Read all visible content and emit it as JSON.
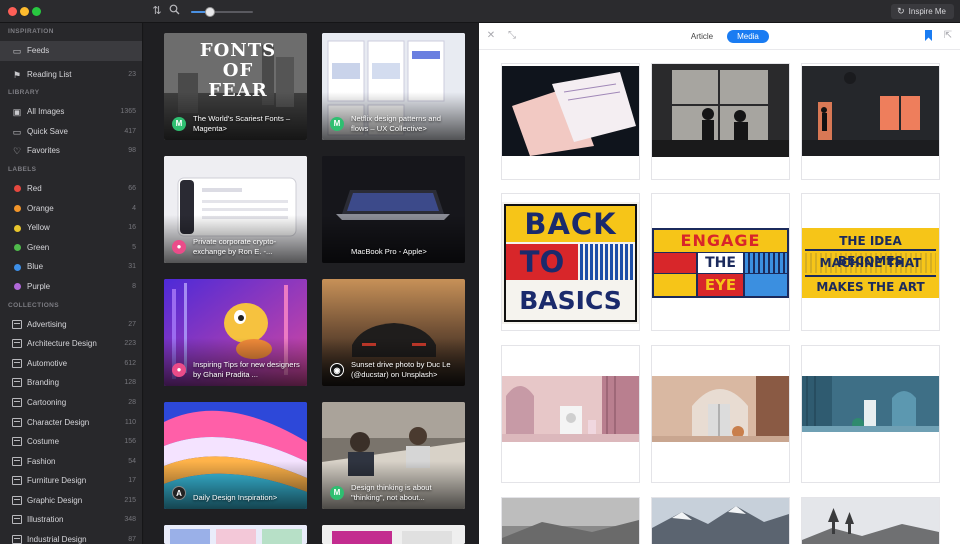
{
  "toolbar": {
    "zoom_percent": 30,
    "inspire_label": "Inspire Me"
  },
  "sidebar": {
    "inspiration_header": "INSPIRATION",
    "feeds_label": "Feeds",
    "reading_list": {
      "label": "Reading List",
      "count": "23"
    },
    "library_header": "LIBRARY",
    "library": [
      {
        "label": "All Images",
        "count": "1365",
        "icon": "images-icon"
      },
      {
        "label": "Quick Save",
        "count": "417",
        "icon": "folder-icon"
      },
      {
        "label": "Favorites",
        "count": "98",
        "icon": "heart-icon"
      }
    ],
    "labels_header": "LABELS",
    "labels": [
      {
        "label": "Red",
        "count": "66",
        "color": "#e5483f"
      },
      {
        "label": "Orange",
        "count": "4",
        "color": "#f2952a"
      },
      {
        "label": "Yellow",
        "count": "16",
        "color": "#e8c52c"
      },
      {
        "label": "Green",
        "count": "5",
        "color": "#4fba4b"
      },
      {
        "label": "Blue",
        "count": "31",
        "color": "#3d8fe8"
      },
      {
        "label": "Purple",
        "count": "8",
        "color": "#b068d8"
      }
    ],
    "collections_header": "COLLECTIONS",
    "collections": [
      {
        "label": "Advertising",
        "count": "27"
      },
      {
        "label": "Architecture Design",
        "count": "223"
      },
      {
        "label": "Automotive",
        "count": "612"
      },
      {
        "label": "Branding",
        "count": "128"
      },
      {
        "label": "Cartooning",
        "count": "28"
      },
      {
        "label": "Character Design",
        "count": "110"
      },
      {
        "label": "Costume",
        "count": "156"
      },
      {
        "label": "Fashion",
        "count": "54"
      },
      {
        "label": "Furniture Design",
        "count": "17"
      },
      {
        "label": "Graphic Design",
        "count": "215"
      },
      {
        "label": "Illustration",
        "count": "348"
      },
      {
        "label": "Industrial Design",
        "count": "87"
      }
    ]
  },
  "feed": {
    "cards": [
      {
        "caption": "The World's Scariest Fonts – Magenta>",
        "badge": "M",
        "badge_color": "#2fbf71",
        "art_text": "FONTS OF FEAR"
      },
      {
        "caption": "Netflix design patterns and flows – UX Collective>",
        "badge": "M",
        "badge_color": "#2fbf71"
      },
      {
        "caption": "Private corporate crypto-exchange by Ron E. -...",
        "badge": "●",
        "badge_color": "#ea4c89"
      },
      {
        "caption": "MacBook Pro - Apple>",
        "badge": "",
        "badge_color": "#222"
      },
      {
        "caption": "Inspiring Tips for new designers by Ghani Pradita ...",
        "badge": "●",
        "badge_color": "#ea4c89"
      },
      {
        "caption": "Sunset drive photo by Duc Le (@ducstar) on Unsplash>",
        "badge": "◉",
        "badge_color": "#111"
      },
      {
        "caption": "Daily Design Inspiration>",
        "badge": "A",
        "badge_color": "#222"
      },
      {
        "caption": "Design thinking is about \"thinking\", not about...",
        "badge": "M",
        "badge_color": "#2fbf71"
      }
    ]
  },
  "pane": {
    "article_label": "Article",
    "media_label": "Media",
    "posters": [
      {
        "lines": [
          "BACK",
          "TO",
          "BASICS"
        ]
      },
      {
        "lines": [
          "ENGAGE",
          "THE",
          "EYE"
        ]
      },
      {
        "lines": [
          "THE IDEA BECOMES",
          "MACHINE THAT",
          "MAKES THE ART"
        ]
      }
    ]
  }
}
